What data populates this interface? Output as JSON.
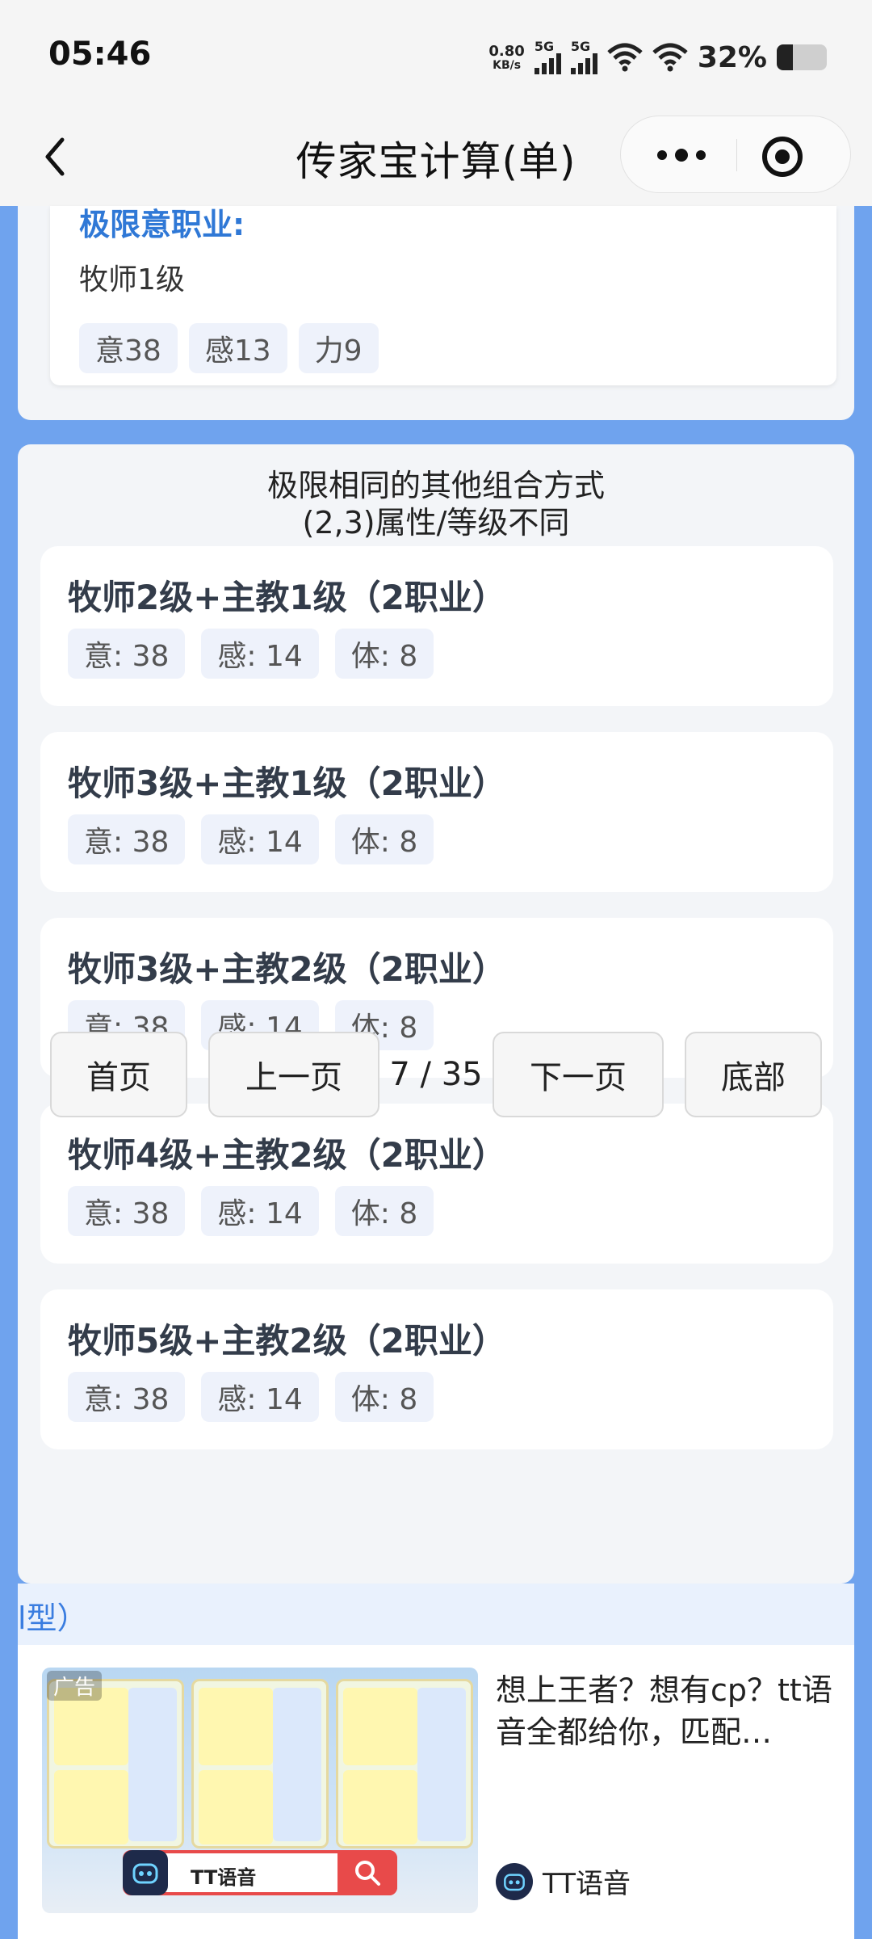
{
  "status_bar": {
    "time": "05:46",
    "net_speed_value": "0.80",
    "net_speed_unit": "KB/s",
    "sim1_label": "5G",
    "sim2_label": "5G",
    "battery_percent": "32%",
    "battery_level": 0.32
  },
  "nav": {
    "title": "传家宝计算(单)"
  },
  "top_card": {
    "heading": "极限意职业:",
    "job": "牧师1级",
    "tags": [
      "意38",
      "感13",
      "力9"
    ]
  },
  "section": {
    "title_line1": "极限相同的其他组合方式",
    "title_line2": "(2,3)属性/等级不同"
  },
  "results": [
    {
      "title": "牧师2级+主教1级（2职业）",
      "tags": [
        "意: 38",
        "感: 14",
        "体: 8"
      ]
    },
    {
      "title": "牧师3级+主教1级（2职业）",
      "tags": [
        "意: 38",
        "感: 14",
        "体: 8"
      ]
    },
    {
      "title": "牧师3级+主教2级（2职业）",
      "tags": [
        "意: 38",
        "感: 14",
        "体: 8"
      ]
    },
    {
      "title": "牧师4级+主教2级（2职业）",
      "tags": [
        "意: 38",
        "感: 14",
        "体: 8"
      ]
    },
    {
      "title": "牧师5级+主教2级（2职业）",
      "tags": [
        "意: 38",
        "感: 14",
        "体: 8"
      ]
    }
  ],
  "pager": {
    "first": "首页",
    "prev": "上一页",
    "info": "7 / 35",
    "next": "下一页",
    "last": "底部"
  },
  "ad": {
    "strip_text": "l型）",
    "badge": "广告",
    "search_label": "TT语音",
    "text": "想上王者？想有cp？tt语音全都给你，匹配…",
    "brand": "TT语音"
  }
}
